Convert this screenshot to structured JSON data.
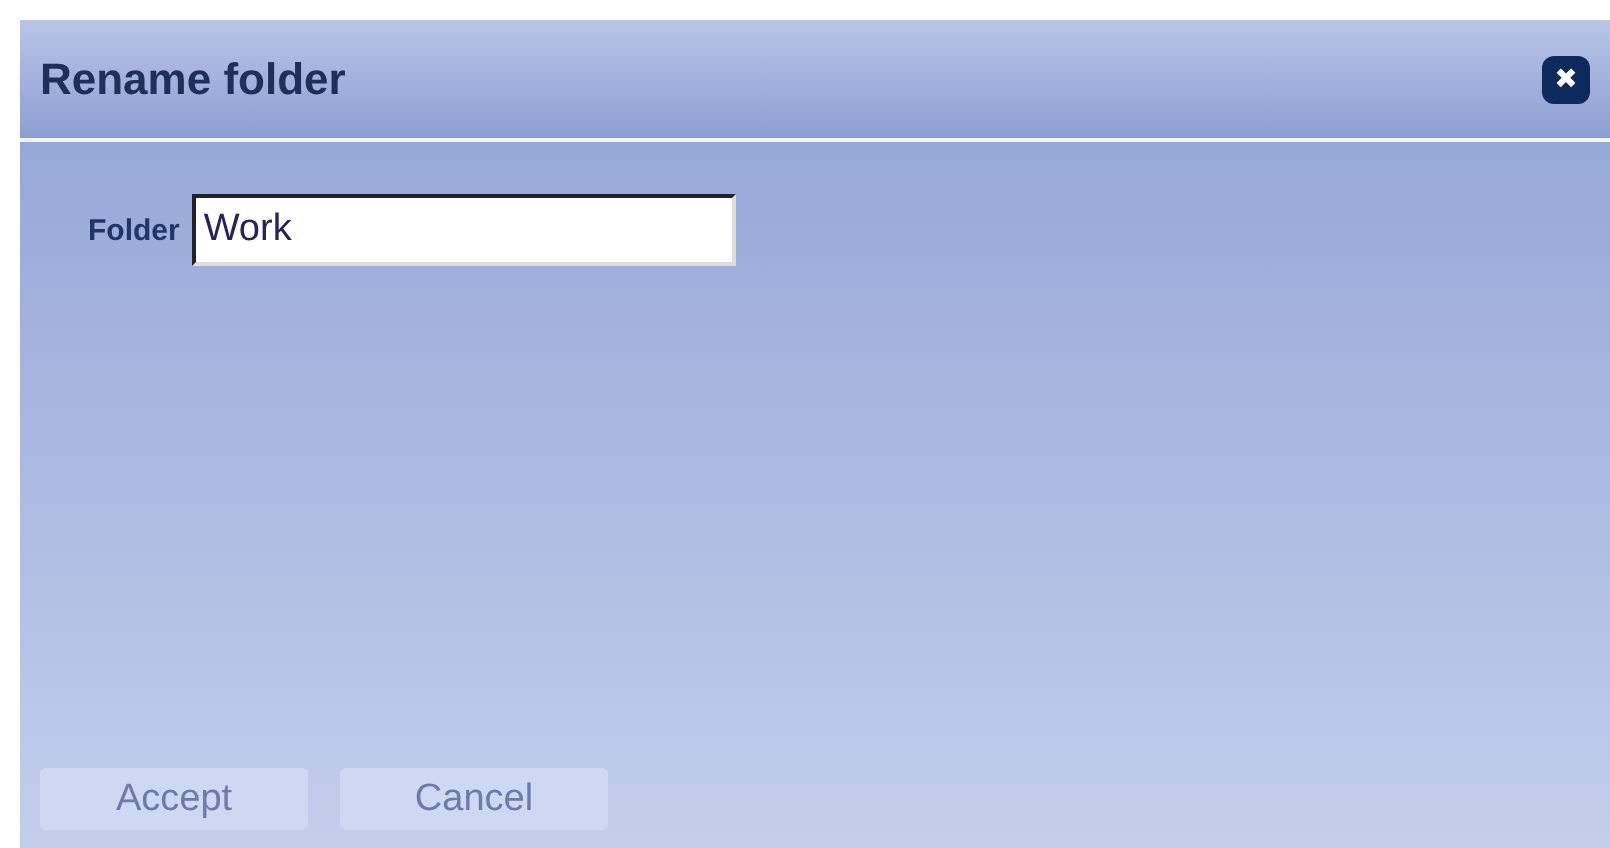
{
  "dialog": {
    "title": "Rename folder",
    "close": "✖"
  },
  "field": {
    "label": "Folder",
    "value": "Work"
  },
  "buttons": [
    "Accept",
    "Cancel"
  ]
}
